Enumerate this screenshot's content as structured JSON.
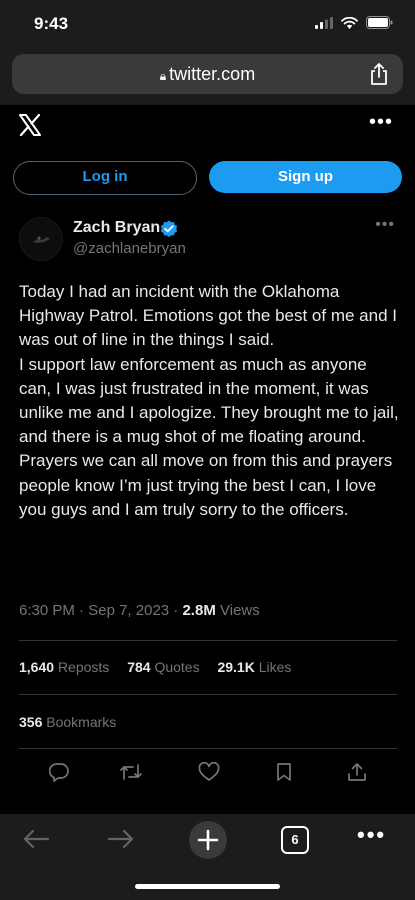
{
  "status_bar": {
    "time": "9:43"
  },
  "browser": {
    "url": "twitter.com",
    "tab_count": "6"
  },
  "header": {
    "more": "•••"
  },
  "auth": {
    "login_label": "Log in",
    "signup_label": "Sign up"
  },
  "tweet": {
    "author_name": "Zach Bryan",
    "author_handle": "@zachlanebryan",
    "more": "•••",
    "paragraphs": [
      "Today I had an incident with the Oklahoma Highway Patrol. Emotions got the best of me and I was out of line in the things I said.",
      "I support law enforcement as much as anyone can, I was just frustrated in the moment, it was unlike me and I apologize. They brought me to jail, and there is a mug shot of me floating around.",
      "Prayers we can all move on from this and prayers people know I’m just trying the best I can, I love you guys and I am truly sorry to the officers."
    ],
    "time": "6:30 PM",
    "date": "Sep 7, 2023",
    "views_count": "2.8M",
    "views_label": "Views",
    "reposts_count": "1,640",
    "reposts_label": "Reposts",
    "quotes_count": "784",
    "quotes_label": "Quotes",
    "likes_count": "29.1K",
    "likes_label": "Likes",
    "bookmarks_count": "356",
    "bookmarks_label": "Bookmarks"
  },
  "colors": {
    "accent": "#1d9bf0",
    "background": "#000000",
    "muted": "#71767b"
  }
}
